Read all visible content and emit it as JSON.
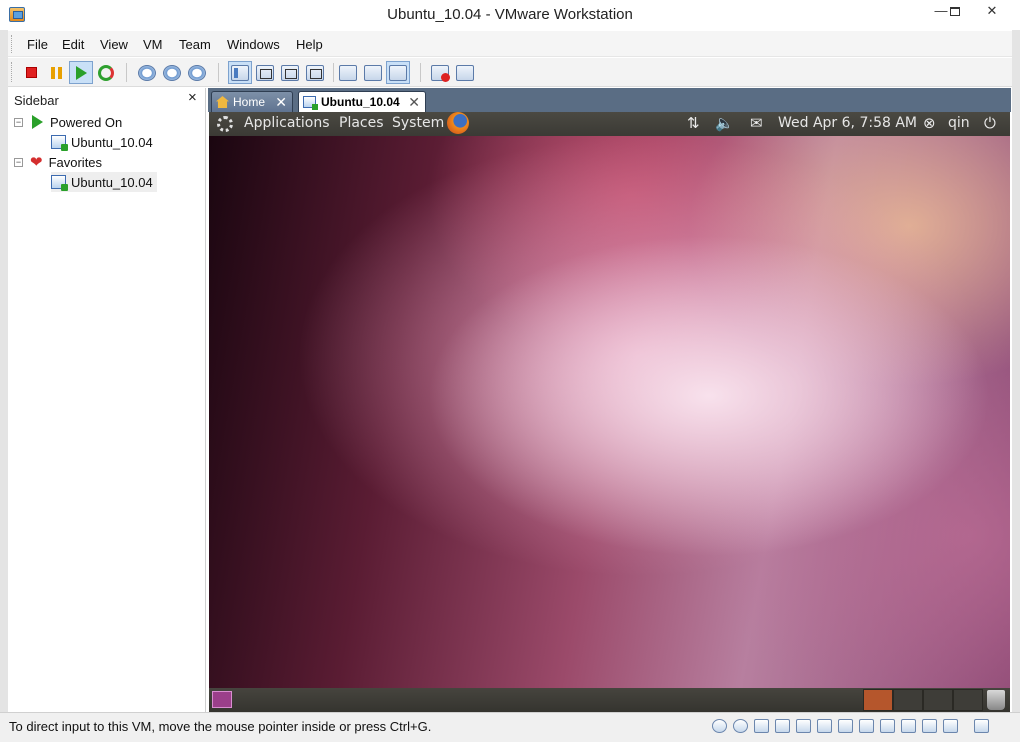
{
  "window": {
    "title": "Ubuntu_10.04 - VMware Workstation",
    "minimize_label": "—",
    "close_label": "✕"
  },
  "menu": {
    "items": [
      "File",
      "Edit",
      "View",
      "VM",
      "Team",
      "Windows",
      "Help"
    ]
  },
  "toolbar": {
    "buttons": [
      {
        "name": "power-off-icon",
        "active": false
      },
      {
        "name": "suspend-icon",
        "active": false
      },
      {
        "name": "power-on-icon",
        "active": true
      },
      {
        "name": "reset-icon",
        "active": false
      },
      {
        "name": "snapshot-icon",
        "active": false
      },
      {
        "name": "revert-snapshot-icon",
        "active": false
      },
      {
        "name": "snapshot-manager-icon",
        "active": false
      },
      {
        "name": "show-sidebar-icon",
        "active": true
      },
      {
        "name": "quick-switch-icon",
        "active": false
      },
      {
        "name": "full-screen-icon",
        "active": false
      },
      {
        "name": "unity-icon",
        "active": false
      },
      {
        "name": "console-view-icon",
        "active": false
      },
      {
        "name": "summary-view-icon",
        "active": false
      },
      {
        "name": "thumbnail-view-icon",
        "active": true
      },
      {
        "name": "record-icon",
        "active": false
      },
      {
        "name": "replay-icon",
        "active": false
      }
    ]
  },
  "sidebar": {
    "title": "Sidebar",
    "close_label": "×",
    "groups": [
      {
        "label": "Powered On",
        "icon": "powered-on-icon",
        "children": [
          "Ubuntu_10.04"
        ]
      },
      {
        "label": "Favorites",
        "icon": "heart-icon",
        "children": [
          "Ubuntu_10.04"
        ]
      }
    ]
  },
  "tabs": [
    {
      "label": "Home",
      "icon": "home-icon",
      "active": false
    },
    {
      "label": "Ubuntu_10.04",
      "icon": "vm-icon",
      "active": true
    }
  ],
  "guest": {
    "panel": {
      "menus": [
        "Applications",
        "Places",
        "System"
      ],
      "datetime": "Wed Apr  6,  7:58 AM",
      "user": "qin"
    },
    "workspaces": 4,
    "active_workspace": 1
  },
  "status": {
    "message": "To direct input to this VM, move the mouse pointer inside or press Ctrl+G.",
    "device_icons": [
      "hard-disk-icon",
      "cd-icon",
      "floppy-icon",
      "network-icon",
      "usb-icon",
      "sound-icon",
      "printer-icon",
      "display-icon",
      "serial-icon",
      "bluetooth-icon",
      "message-icon",
      "fullscreen-icon"
    ]
  },
  "colors": {
    "tab_bar": "#5a6d84",
    "gnome_panel": "#3c3b37",
    "active_workspace": "#b5562c",
    "play_green": "#2aa02a",
    "stop_red": "#e02020"
  }
}
